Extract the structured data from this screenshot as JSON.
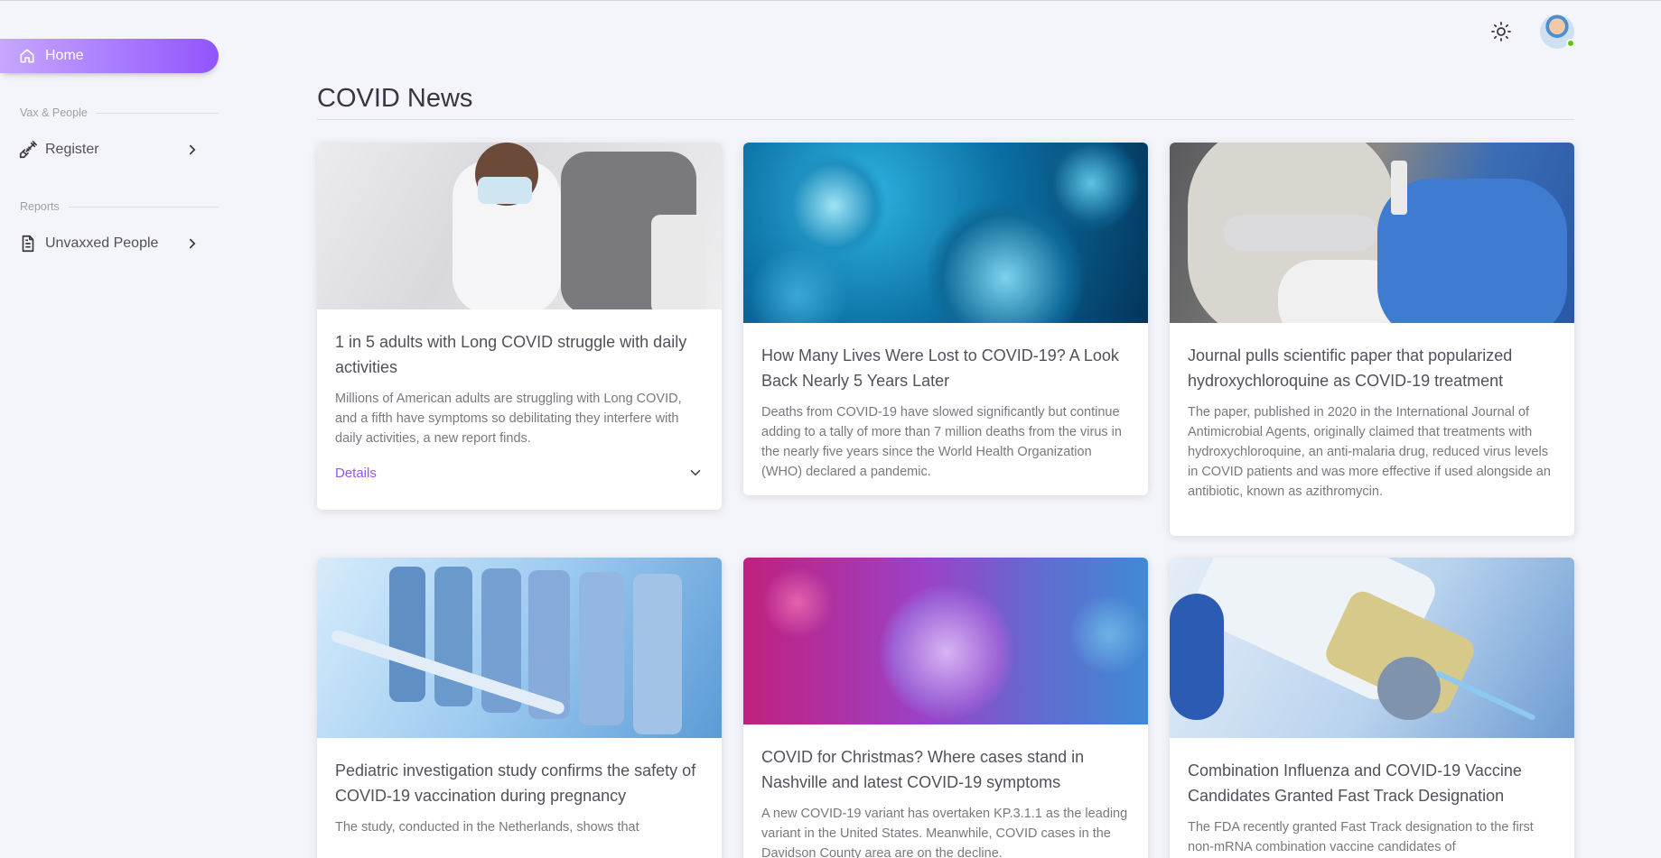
{
  "sidebar": {
    "home_label": "Home",
    "section_vax": "Vax & People",
    "register_label": "Register",
    "section_reports": "Reports",
    "unvaxxed_label": "Unvaxxed People"
  },
  "colors": {
    "accent": "#9155fd",
    "status_online": "#56ca00"
  },
  "main": {
    "title": "COVID News",
    "cards": [
      {
        "title": "1 in 5 adults with Long COVID struggle with daily activities",
        "text": "Millions of American adults are struggling with Long COVID, and a fifth have symptoms so debilitating they interfere with daily activities, a new report finds.",
        "details_label": "Details"
      },
      {
        "title": "How Many Lives Were Lost to COVID-19? A Look Back Nearly 5 Years Later",
        "text": "Deaths from COVID-19 have slowed significantly but continue adding to a tally of more than 7 million deaths from the virus in the nearly five years since the World Health Organization (WHO) declared a pandemic."
      },
      {
        "title": "Journal pulls scientific paper that popularized hydroxychloroquine as COVID-19 treatment",
        "text": "The paper, published in 2020 in the International Journal of Antimicrobial Agents, originally claimed that treatments with hydroxychloroquine, an anti-malaria drug, reduced virus levels in COVID patients and was more effective if used alongside an antibiotic, known as azithromycin."
      },
      {
        "title": "Pediatric investigation study confirms the safety of COVID-19 vaccination during pregnancy",
        "text": "The study, conducted in the Netherlands, shows that"
      },
      {
        "title": "COVID for Christmas? Where cases stand in Nashville and latest COVID-19 symptoms",
        "text": "A new COVID-19 variant has overtaken KP.3.1.1 as the leading variant in the United States. Meanwhile, COVID cases in the Davidson County area are on the decline."
      },
      {
        "title": "Combination Influenza and COVID-19 Vaccine Candidates Granted Fast Track Designation",
        "text": "The FDA recently granted Fast Track designation to the first non-mRNA combination vaccine candidates of"
      }
    ]
  }
}
